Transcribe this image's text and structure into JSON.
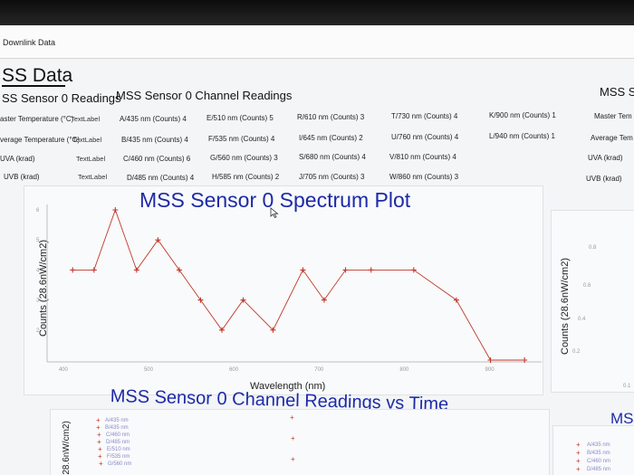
{
  "window": {
    "title": "Downlink Data"
  },
  "page": {
    "heading": "SS Data"
  },
  "sections": {
    "readings_header": "SS Sensor 0 Readings",
    "channel_header": "MSS Sensor 0 Channel Readings",
    "right_header": "MSS S"
  },
  "readings": [
    {
      "label": "aster Temperature (°C)",
      "value": "TextLabel"
    },
    {
      "label": "verage Temperature (°C)",
      "value": "TextLabel"
    },
    {
      "label": "UVA (krad)",
      "value": "TextLabel"
    },
    {
      "label": "UVB (krad)",
      "value": "TextLabel"
    }
  ],
  "channels": [
    [
      "A/435 nm (Counts)  4",
      "E/510 nm (Counts)  5",
      "R/610 nm (Counts)  3",
      "T/730 nm (Counts)  4",
      "K/900 nm (Counts)  1"
    ],
    [
      "B/435 nm (Counts)  4",
      "F/535 nm (Counts)  4",
      "I/645 nm (Counts)  2",
      "U/760 nm (Counts)  4",
      "L/940 nm (Counts)  1"
    ],
    [
      "C/460 nm (Counts)  6",
      "G/560 nm (Counts)  3",
      "S/680 nm (Counts)  4",
      "V/810 nm (Counts)  4",
      ""
    ],
    [
      "D/485 nm (Counts)  4",
      "H/585 nm (Counts)  2",
      "J/705 nm (Counts)  3",
      "W/860 nm (Counts)  3",
      ""
    ]
  ],
  "right_readings": [
    "Master Tem",
    "Average Tem",
    "UVA (krad)",
    "UVB (krad)"
  ],
  "spectrum": {
    "title": "MSS Sensor 0 Spectrum Plot",
    "xlabel": "Wavelength (nm)",
    "ylabel": "Counts (28.6nW/cm2)"
  },
  "right_plot": {
    "ylabel": "Counts (28.6nW/cm2)",
    "ticks": [
      "0.8",
      "0.6",
      "0.4",
      "0.2"
    ],
    "xtick": "0.1"
  },
  "time_plot": {
    "title": "MSS Sensor 0 Channel Readings vs Time",
    "ylabel": "(28.6nW/cm2)",
    "legend": [
      "A/435 nm",
      "B/435 nm",
      "C/460 nm",
      "D/485 nm",
      "E/510 nm",
      "F/535 nm",
      "G/560 nm"
    ],
    "right_title": "MS",
    "right_legend": [
      "A/435 nm",
      "B/435 nm",
      "C/460 nm",
      "D/485 nm"
    ]
  },
  "chart_data": {
    "type": "line",
    "title": "MSS Sensor 0 Spectrum Plot",
    "xlabel": "Wavelength (nm)",
    "ylabel": "Counts (28.6nW/cm2)",
    "xlim": [
      380,
      960
    ],
    "ylim": [
      1,
      6
    ],
    "xticks": [
      400,
      500,
      600,
      700,
      800,
      900
    ],
    "yticks": [
      2,
      3,
      4,
      5,
      6
    ],
    "color": "#c0392b",
    "series": [
      {
        "x": [
          410,
          435,
          460,
          485,
          510,
          535,
          560,
          585,
          610,
          645,
          680,
          705,
          730,
          760,
          810,
          860,
          900,
          940
        ],
        "y": [
          4,
          4,
          6,
          4,
          5,
          4,
          3,
          2,
          3,
          2,
          4,
          3,
          4,
          4,
          4,
          3,
          1,
          1
        ]
      }
    ]
  }
}
